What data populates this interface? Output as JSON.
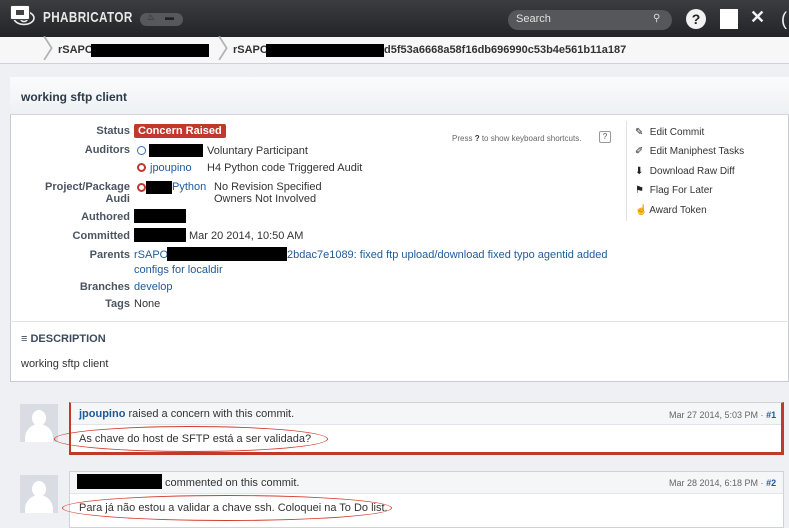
{
  "app": {
    "brand": "PHABRICATOR",
    "search_placeholder": "Search"
  },
  "breadcrumb": {
    "repo": "rSAPO",
    "commit_prefix": "rSAPO",
    "commit_hash": "d5f53a6668a58f16db696990c53b4e561b11a187"
  },
  "commit": {
    "title": "working sftp client",
    "status_label": "Status",
    "status": "Concern Raised",
    "auditors_label": "Auditors",
    "auditors": [
      {
        "name": "",
        "role": "Voluntary Participant"
      },
      {
        "name": "jpoupino",
        "role": "H4 Python code Triggered Audit"
      }
    ],
    "project_label": "Project/Package Audi",
    "project": {
      "name": "Python",
      "line1": "No Revision Specified",
      "line2": "Owners Not Involved"
    },
    "authored_label": "Authored",
    "committed_label": "Committed",
    "committed": "Mar 20 2014, 10:50 AM",
    "parents_label": "Parents",
    "parents_prefix": "rSAPO",
    "parents_link": "2bdac7e1089: fixed ftp upload/download fixed typo agentid added",
    "parents_link2": "configs for localdir",
    "branches_label": "Branches",
    "branch": "develop",
    "tags_label": "Tags",
    "tags": "None"
  },
  "shortcut_hint": {
    "prefix": "Press",
    "key": "?",
    "suffix": "to show keyboard shortcuts."
  },
  "actions": [
    {
      "icon": "pencil-icon",
      "glyph": "✎",
      "label": "Edit Commit"
    },
    {
      "icon": "pin-icon",
      "glyph": "✐",
      "label": "Edit Maniphest Tasks"
    },
    {
      "icon": "download-icon",
      "glyph": "⬇",
      "label": "Download Raw Diff"
    },
    {
      "icon": "flag-icon",
      "glyph": "⚑",
      "label": "Flag For Later"
    },
    {
      "icon": "thumbs-up-icon",
      "glyph": "☝",
      "label": "Award Token"
    }
  ],
  "description": {
    "heading": "DESCRIPTION",
    "text": "working sftp client"
  },
  "timeline": [
    {
      "author": "jpoupino",
      "action": "raised a concern with this commit.",
      "date": "Mar 27 2014, 5:03 PM ·",
      "num": "#1",
      "body": "As chave do host de SFTP está a ser validada?"
    },
    {
      "author": "",
      "action": "commented on this commit.",
      "date": "Mar 28 2014, 6:18 PM ·",
      "num": "#2",
      "body": "Para já não estou a validar a chave ssh. Coloquei na To Do list."
    }
  ],
  "colors": {
    "accent": "#c0392b",
    "link": "#1f5a99",
    "topbar": "#2b2c2f"
  }
}
